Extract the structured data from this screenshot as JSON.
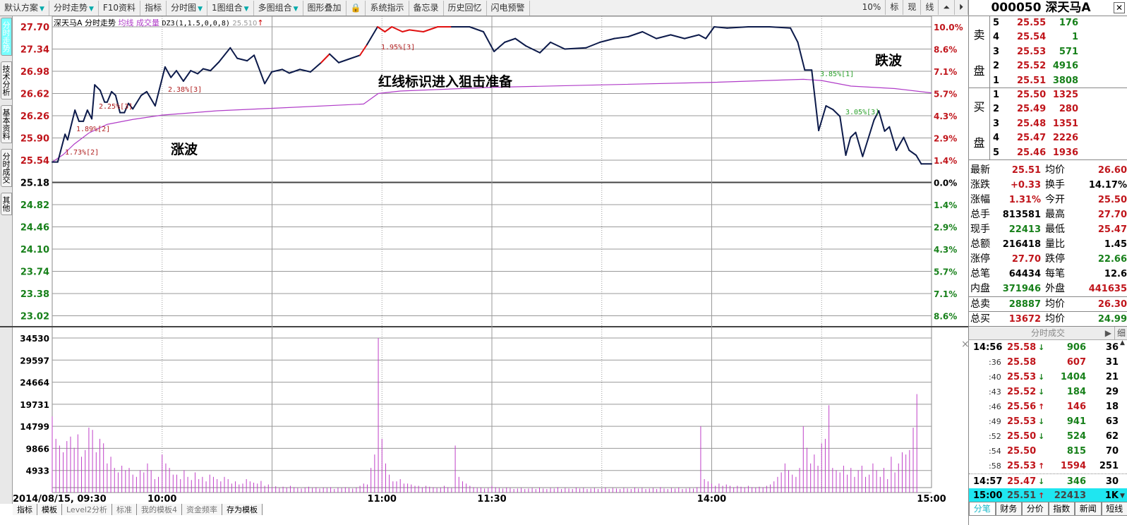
{
  "toolbar": {
    "items": [
      {
        "label": "默认方案",
        "dd": true
      },
      {
        "label": "分时走势",
        "dd": true
      },
      {
        "label": "F10资料",
        "dd": false
      },
      {
        "label": "指标",
        "dd": false
      },
      {
        "label": "分时图",
        "dd": true
      },
      {
        "label": "1图组合",
        "dd": true
      },
      {
        "label": "多图组合",
        "dd": true
      },
      {
        "label": "图形叠加",
        "dd": false
      },
      {
        "label": "系统指示",
        "dd": false
      },
      {
        "label": "备忘录",
        "dd": false
      },
      {
        "label": "历史回忆",
        "dd": false
      },
      {
        "label": "闪电预警",
        "dd": false
      }
    ],
    "right": [
      "10%",
      "标",
      "现",
      "线"
    ]
  },
  "left_tabs": [
    "分时走势",
    "技术分析",
    "基本资料",
    "分时成交",
    "其他"
  ],
  "chart_header": {
    "name": "深天马A 分时走势",
    "avg": "均线",
    "vol": "成交量",
    "indicator": "DZ3(1,1.5,0,0,8)",
    "value": "25.510",
    "arrow": "↑"
  },
  "bottom_tabs": [
    "指标",
    "模板",
    "Level2分析",
    "标准",
    "我的模板4",
    "资金频率",
    "存为模板"
  ],
  "annotations": {
    "rise": "涨波",
    "fall": "跌波",
    "red_note": "红线标识进入狙击准备",
    "waves": [
      {
        "text": "1.73%[2]",
        "color": "red"
      },
      {
        "text": "1.89%[2]",
        "color": "red"
      },
      {
        "text": "2.25%[3]",
        "color": "red"
      },
      {
        "text": "2.38%[3]",
        "color": "red"
      },
      {
        "text": "1.95%[3]",
        "color": "red"
      },
      {
        "text": "3.85%[1]",
        "color": "green"
      },
      {
        "text": "3.05%[3]",
        "color": "green"
      }
    ]
  },
  "colors": {
    "up": "#c0151b",
    "down": "#17801a",
    "price_line": "#0c1a4a",
    "avg_line": "#b03cc8",
    "volume": "#c040c8",
    "highlight": "#1fe6f0"
  },
  "chart_data": {
    "type": "line",
    "title": "深天马A 分时走势",
    "date_label": "2014/08/15, 09:30",
    "x_ticks": [
      "10:00",
      "11:00",
      "11:30",
      "14:00",
      "15:00"
    ],
    "price_ticks": [
      "27.70",
      "27.34",
      "26.98",
      "26.62",
      "26.26",
      "25.90",
      "25.54",
      "25.18",
      "24.82",
      "24.46",
      "24.10",
      "23.74",
      "23.38",
      "23.02"
    ],
    "pct_ticks": [
      "10.0%",
      "8.6%",
      "7.1%",
      "5.7%",
      "4.3%",
      "2.9%",
      "1.4%",
      "0.0%",
      "1.4%",
      "2.9%",
      "4.3%",
      "5.7%",
      "7.1%",
      "8.6%"
    ],
    "vol_ticks": [
      "34530",
      "29597",
      "24664",
      "19731",
      "14799",
      "9866",
      "4933"
    ],
    "prev_close": 25.18,
    "ylim": [
      23.02,
      27.7
    ],
    "vol_max": 34530,
    "minutes": 240,
    "price": [
      [
        0,
        25.51
      ],
      [
        1.5,
        25.51
      ],
      [
        3.5,
        25.96
      ],
      [
        4.2,
        25.87
      ],
      [
        6.2,
        26.35
      ],
      [
        7.3,
        26.17
      ],
      [
        8.5,
        26.17
      ],
      [
        9.6,
        26.35
      ],
      [
        10.8,
        26.21
      ],
      [
        11.6,
        26.76
      ],
      [
        13.1,
        26.67
      ],
      [
        14.3,
        26.48
      ],
      [
        15,
        26.48
      ],
      [
        16.2,
        26.65
      ],
      [
        17.3,
        26.59
      ],
      [
        18.5,
        26.31
      ],
      [
        19.7,
        26.31
      ],
      [
        20.8,
        26.46
      ],
      [
        22,
        26.37
      ],
      [
        24.3,
        26.59
      ],
      [
        25.8,
        26.65
      ],
      [
        28.1,
        26.42
      ],
      [
        30.8,
        27.05
      ],
      [
        32.4,
        26.88
      ],
      [
        33.9,
        26.99
      ],
      [
        35.8,
        26.82
      ],
      [
        37.8,
        26.99
      ],
      [
        39.7,
        26.94
      ],
      [
        41.2,
        27.02
      ],
      [
        43.2,
        26.99
      ],
      [
        45.5,
        27.13
      ],
      [
        48.6,
        27.36
      ],
      [
        50.5,
        27.19
      ],
      [
        53.2,
        27.15
      ],
      [
        55.1,
        27.24
      ],
      [
        58,
        26.78
      ],
      [
        59.9,
        26.97
      ],
      [
        62.8,
        27.01
      ],
      [
        64.7,
        26.95
      ],
      [
        67.6,
        27.01
      ],
      [
        70.5,
        26.97
      ],
      [
        73.4,
        27.12
      ],
      [
        75.7,
        27.26
      ],
      [
        78.2,
        27.12
      ],
      [
        81.1,
        27.18
      ],
      [
        84,
        27.24
      ],
      [
        85.9,
        27.41
      ],
      [
        88.8,
        27.7
      ],
      [
        90.8,
        27.62
      ],
      [
        92.7,
        27.7
      ],
      [
        95.6,
        27.62
      ],
      [
        97.5,
        27.65
      ],
      [
        101.3,
        27.62
      ],
      [
        105.2,
        27.7
      ],
      [
        109,
        27.7
      ],
      [
        113.9,
        27.7
      ],
      [
        117.7,
        27.62
      ],
      [
        120.6,
        27.3
      ],
      [
        123.5,
        27.45
      ],
      [
        126.4,
        27.51
      ],
      [
        129.3,
        27.39
      ],
      [
        133.1,
        27.28
      ],
      [
        136,
        27.45
      ],
      [
        139.9,
        27.34
      ],
      [
        145.7,
        27.36
      ],
      [
        149.5,
        27.45
      ],
      [
        153.4,
        27.51
      ],
      [
        157.2,
        27.54
      ],
      [
        161.1,
        27.62
      ],
      [
        164.9,
        27.51
      ],
      [
        168.8,
        27.57
      ],
      [
        172.6,
        27.51
      ],
      [
        176.5,
        27.57
      ],
      [
        178.4,
        27.51
      ],
      [
        180.7,
        27.7
      ],
      [
        184.2,
        27.68
      ],
      [
        190,
        27.7
      ],
      [
        195.8,
        27.7
      ],
      [
        201.5,
        27.68
      ],
      [
        203.5,
        27.45
      ],
      [
        205.4,
        27.0
      ],
      [
        207.3,
        27.0
      ],
      [
        209.2,
        26.02
      ],
      [
        211.2,
        26.42
      ],
      [
        213.1,
        26.36
      ],
      [
        215,
        26.25
      ],
      [
        216.6,
        25.62
      ],
      [
        217.9,
        25.91
      ],
      [
        219.3,
        25.99
      ],
      [
        221.2,
        25.6
      ],
      [
        224.3,
        26.19
      ],
      [
        225.6,
        26.34
      ],
      [
        227.2,
        26.01
      ],
      [
        228.5,
        26.08
      ],
      [
        230.4,
        25.7
      ],
      [
        232.4,
        25.91
      ],
      [
        233.9,
        25.7
      ],
      [
        235.8,
        25.62
      ],
      [
        237.2,
        25.48
      ],
      [
        240,
        25.48
      ]
    ],
    "red_ranges": [
      [
        74,
        76.5
      ],
      [
        83,
        85.5
      ],
      [
        88,
        110
      ]
    ],
    "avg": [
      [
        0,
        25.51
      ],
      [
        3,
        25.63
      ],
      [
        6,
        25.8
      ],
      [
        10,
        25.98
      ],
      [
        15,
        26.12
      ],
      [
        22,
        26.2
      ],
      [
        30,
        26.27
      ],
      [
        45,
        26.34
      ],
      [
        60,
        26.38
      ],
      [
        85,
        26.45
      ],
      [
        89,
        26.62
      ],
      [
        95,
        26.66
      ],
      [
        120,
        26.72
      ],
      [
        180,
        26.8
      ],
      [
        205,
        26.85
      ],
      [
        210,
        26.83
      ],
      [
        218,
        26.74
      ],
      [
        230,
        26.7
      ],
      [
        240,
        26.63
      ]
    ],
    "volume": [
      17000,
      12000,
      10500,
      9000,
      11500,
      12500,
      10000,
      13000,
      8000,
      9500,
      14500,
      14000,
      9000,
      12000,
      11000,
      6500,
      8000,
      5500,
      4500,
      6000,
      5000,
      5500,
      4000,
      3500,
      5000,
      4500,
      6500,
      5000,
      3000,
      3500,
      8500,
      6500,
      5500,
      4000,
      4000,
      3000,
      5000,
      3500,
      2800,
      4500,
      3000,
      3500,
      2500,
      4000,
      3500,
      3000,
      2500,
      3500,
      3000,
      2000,
      2500,
      1800,
      2000,
      3000,
      2500,
      2200,
      2000,
      2600,
      1500,
      1800,
      1200,
      1400,
      1000,
      1300,
      1100,
      1500,
      1200,
      1000,
      900,
      1100,
      1300,
      1000,
      1200,
      900,
      1100,
      1000,
      1200,
      800,
      1100,
      1000,
      1200,
      1000,
      900,
      1100,
      1500,
      2000,
      1800,
      5500,
      8500,
      34530,
      12000,
      6500,
      4000,
      2500,
      2500,
      3000,
      2000,
      2000,
      1800,
      1500,
      1500,
      1200,
      1500,
      1300,
      1200,
      1000,
      1100,
      1500,
      1200,
      1000,
      10500,
      3500,
      2500,
      2000,
      1500,
      1200,
      1000,
      1100,
      900,
      1000,
      1500,
      1200,
      1000,
      900,
      1100,
      1000,
      800,
      900,
      1000,
      800,
      900,
      1000,
      800,
      1100,
      900,
      800,
      1000,
      900,
      1200,
      800,
      1000,
      900,
      800,
      1100,
      900,
      1000,
      800,
      900,
      1000,
      800,
      900,
      1100,
      800,
      1000,
      900,
      800,
      1000,
      900,
      800,
      1100,
      900,
      1000,
      800,
      900,
      1000,
      800,
      1200,
      900,
      800,
      1000,
      900,
      1100,
      800,
      900,
      1000,
      900,
      1200,
      14800,
      3000,
      2500,
      2000,
      1500,
      2000,
      1500,
      1800,
      1500,
      1200,
      1500,
      1300,
      1200,
      1500,
      1200,
      1100,
      1300,
      1200,
      1500,
      1800,
      2500,
      3500,
      4500,
      6500,
      5000,
      4000,
      3500,
      5500,
      14800,
      10000,
      6500,
      8500,
      6000,
      11000,
      12000,
      19500,
      5500,
      5000,
      4500,
      6000,
      4000,
      5500,
      3500,
      5000,
      6000,
      3500,
      4000,
      6500,
      5000,
      3500,
      5500,
      3000,
      8000,
      4500,
      6500,
      9000,
      8500,
      9500,
      14500,
      22000
    ]
  },
  "panel": {
    "code": "000050",
    "name": "深天马A",
    "sell_label": [
      "卖",
      "盘"
    ],
    "buy_label": [
      "买",
      "盘"
    ],
    "sell": [
      {
        "lv": "5",
        "price": "25.55",
        "vol": "176"
      },
      {
        "lv": "4",
        "price": "25.54",
        "vol": "1"
      },
      {
        "lv": "3",
        "price": "25.53",
        "vol": "571"
      },
      {
        "lv": "2",
        "price": "25.52",
        "vol": "4916"
      },
      {
        "lv": "1",
        "price": "25.51",
        "vol": "3808"
      }
    ],
    "buy": [
      {
        "lv": "1",
        "price": "25.50",
        "vol": "1325"
      },
      {
        "lv": "2",
        "price": "25.49",
        "vol": "280"
      },
      {
        "lv": "3",
        "price": "25.48",
        "vol": "1351"
      },
      {
        "lv": "4",
        "price": "25.47",
        "vol": "2226"
      },
      {
        "lv": "5",
        "price": "25.46",
        "vol": "1936"
      }
    ],
    "stats": [
      {
        "k1": "最新",
        "v1": "25.51",
        "c1": "red",
        "k2": "均价",
        "v2": "26.60",
        "c2": "red"
      },
      {
        "k1": "涨跌",
        "v1": "+0.33",
        "c1": "red",
        "k2": "换手",
        "v2": "14.17%",
        "c2": "black"
      },
      {
        "k1": "涨幅",
        "v1": "1.31%",
        "c1": "red",
        "k2": "今开",
        "v2": "25.50",
        "c2": "red"
      },
      {
        "k1": "总手",
        "v1": "813581",
        "c1": "black",
        "k2": "最高",
        "v2": "27.70",
        "c2": "red"
      },
      {
        "k1": "现手",
        "v1": "22413",
        "c1": "green",
        "k2": "最低",
        "v2": "25.47",
        "c2": "red"
      },
      {
        "k1": "总额",
        "v1": "216418",
        "c1": "black",
        "k2": "量比",
        "v2": "1.45",
        "c2": "black"
      },
      {
        "k1": "涨停",
        "v1": "27.70",
        "c1": "red",
        "k2": "跌停",
        "v2": "22.66",
        "c2": "green"
      },
      {
        "k1": "总笔",
        "v1": "64434",
        "c1": "black",
        "k2": "每笔",
        "v2": "12.6",
        "c2": "black"
      },
      {
        "k1": "内盘",
        "v1": "371946",
        "c1": "green",
        "k2": "外盘",
        "v2": "441635",
        "c2": "red"
      },
      {
        "k1": "总卖",
        "v1": "28887",
        "c1": "green",
        "k2": "均价",
        "v2": "26.30",
        "c2": "red"
      },
      {
        "k1": "总买",
        "v1": "13672",
        "c1": "red",
        "k2": "均价",
        "v2": "24.99",
        "c2": "green"
      }
    ],
    "ticks_title": "分时成交",
    "ticks_detail": "细",
    "ticks": [
      {
        "t": "14:56",
        "p": "25.58",
        "a": "↓",
        "v": "906",
        "vc": "green",
        "n": "36",
        "main": true
      },
      {
        "t": ":36",
        "p": "25.58",
        "a": "",
        "v": "607",
        "vc": "red",
        "n": "31"
      },
      {
        "t": ":40",
        "p": "25.53",
        "a": "↓",
        "v": "1404",
        "vc": "green",
        "n": "21"
      },
      {
        "t": ":43",
        "p": "25.52",
        "a": "↓",
        "v": "184",
        "vc": "green",
        "n": "29"
      },
      {
        "t": ":46",
        "p": "25.56",
        "a": "↑",
        "v": "146",
        "vc": "red",
        "n": "18"
      },
      {
        "t": ":49",
        "p": "25.53",
        "a": "↓",
        "v": "941",
        "vc": "green",
        "n": "63"
      },
      {
        "t": ":52",
        "p": "25.50",
        "a": "↓",
        "v": "524",
        "vc": "green",
        "n": "62"
      },
      {
        "t": ":54",
        "p": "25.50",
        "a": "",
        "v": "815",
        "vc": "green",
        "n": "70"
      },
      {
        "t": ":58",
        "p": "25.53",
        "a": "↑",
        "v": "1594",
        "vc": "red",
        "n": "251"
      },
      {
        "t": "14:57",
        "p": "25.47",
        "a": "↓",
        "v": "346",
        "vc": "green",
        "n": "30",
        "main": true
      },
      {
        "t": "15:00",
        "p": "25.51",
        "a": "↑",
        "v": "22413",
        "vc": "black",
        "n": "1K",
        "main": true,
        "hl": true
      }
    ],
    "tabs": [
      "分笔",
      "财务",
      "分价",
      "指数",
      "新闻",
      "短线"
    ]
  }
}
